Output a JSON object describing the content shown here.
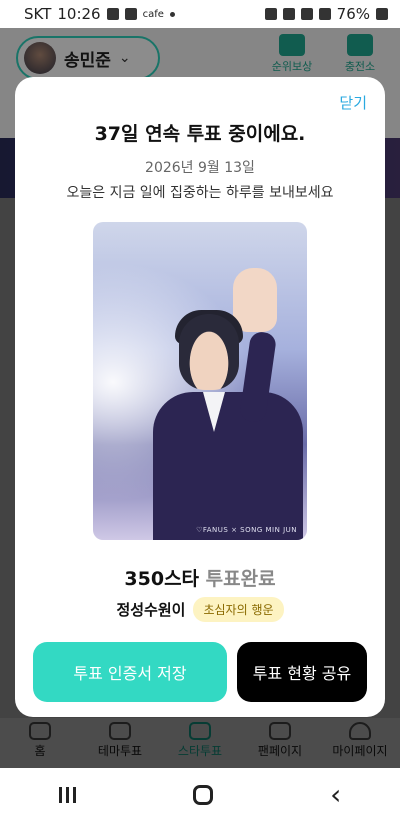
{
  "status_bar": {
    "carrier": "SKT",
    "time": "10:26",
    "app_hint": "cafe",
    "battery": "76%"
  },
  "header": {
    "profile_name": "송민준",
    "buttons": [
      "순위보상",
      "충전소"
    ]
  },
  "modal": {
    "close_label": "닫기",
    "title": "37일 연속 투표 중이에요.",
    "date": "2026년 9월 13일",
    "message": "오늘은 지금 일에 집중하는 하루를 보내보세요",
    "photo_watermark": "♡FANUS × SONG MIN JUN",
    "vote_amount": "350스타",
    "vote_status": "투표완료",
    "user_name": "정성수원이",
    "badge": "초심자의 행운",
    "save_button": "투표 인증서 저장",
    "share_button": "투표 현황 공유"
  },
  "bottom_nav": {
    "items": [
      "홈",
      "테마투표",
      "스타투표",
      "팬페이지",
      "마이페이지"
    ],
    "active": "스타투표"
  },
  "colors": {
    "accent": "#33d9c3",
    "link": "#2aa9e0",
    "badge_bg": "#fdf3c2"
  }
}
